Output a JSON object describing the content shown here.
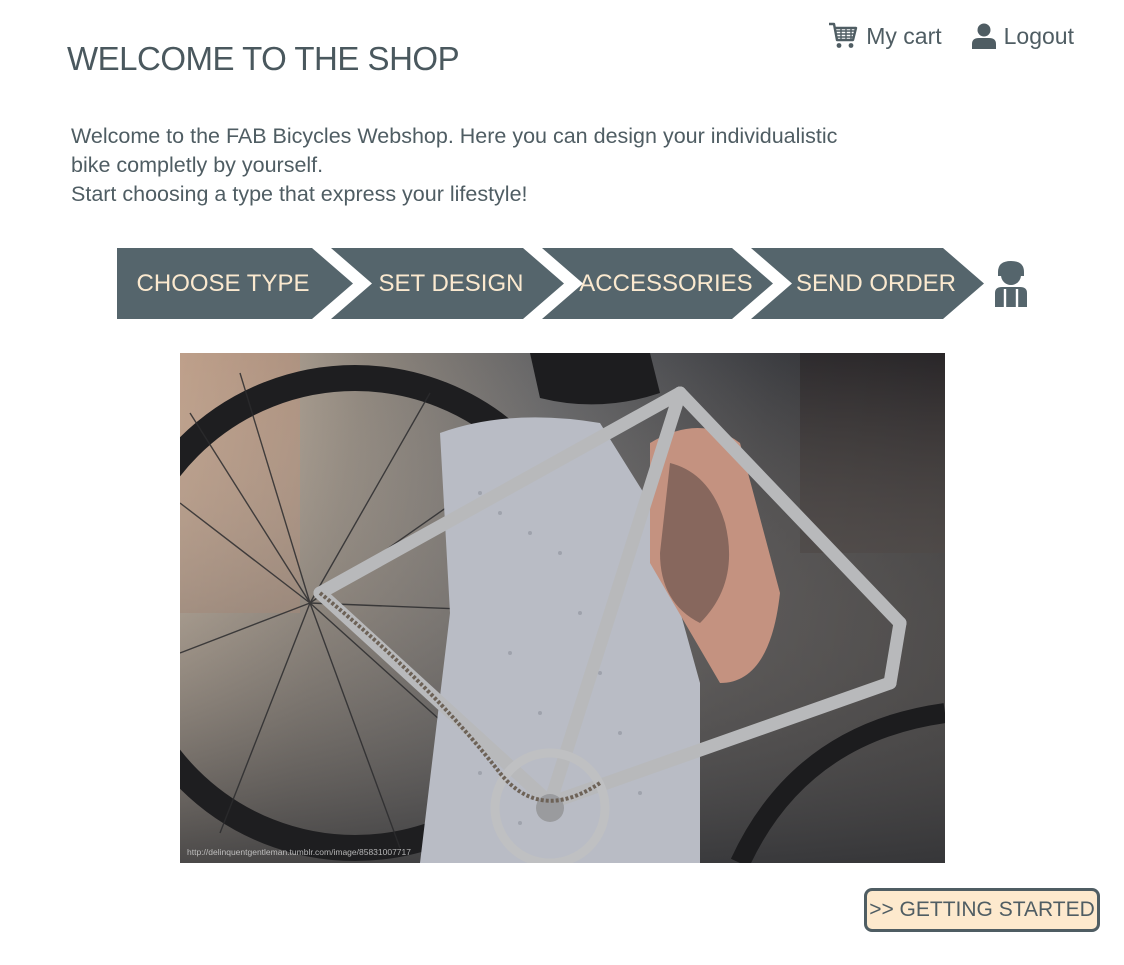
{
  "header": {
    "title": "WELCOME TO THE SHOP",
    "cart_label": "My cart",
    "logout_label": "Logout"
  },
  "intro": {
    "line1": "Welcome to the FAB Bicycles Webshop. Here you can design your individualistic",
    "line2": "bike completly by yourself.",
    "line3": "Start choosing a type that express your lifestyle!"
  },
  "steps": [
    {
      "label": "CHOOSE TYPE"
    },
    {
      "label": "SET DESIGN"
    },
    {
      "label": "ACCESSORIES"
    },
    {
      "label": "SEND ORDER"
    }
  ],
  "hero": {
    "credit": "http://delinquentgentleman.tumblr.com/image/85831007717"
  },
  "cta": {
    "label": ">> GETTING STARTED"
  },
  "icons": {
    "cart": "shopping-cart-icon",
    "logout": "user-icon",
    "progress_end": "person-icon"
  },
  "colors": {
    "step_fill": "#55656c",
    "step_text": "#fbe9cf",
    "text": "#4f5d63",
    "cta_fill": "#fde9cd"
  }
}
